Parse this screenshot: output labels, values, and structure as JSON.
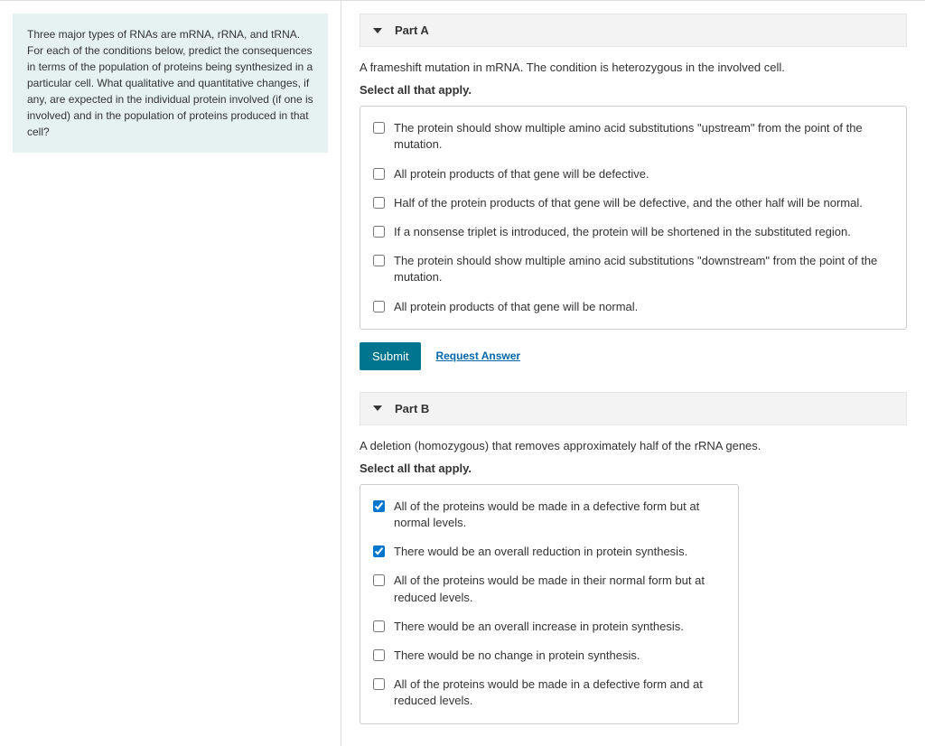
{
  "prompt": "Three major types of RNAs are mRNA, rRNA, and tRNA. For each of the conditions below, predict the consequences in terms of the population of proteins being synthesized in a particular cell. What qualitative and quantitative changes, if any, are expected in the individual protein involved (if one is involved) and in the population of proteins produced in that cell?",
  "partA": {
    "title": "Part A",
    "description": "A frameshift mutation in mRNA. The condition is heterozygous in the involved cell.",
    "selectLabel": "Select all that apply.",
    "options": [
      "The protein should show multiple amino acid substitutions \"upstream\" from the point of the mutation.",
      "All protein products of that gene will be defective.",
      "Half of the protein products of that gene will be defective, and the other half will be normal.",
      "If a nonsense triplet is introduced, the protein will be shortened in the substituted region.",
      "The protein should show multiple amino acid substitutions \"downstream\" from the point of the mutation.",
      "All protein products of that gene will be normal."
    ],
    "checked": [
      false,
      false,
      false,
      false,
      false,
      false
    ],
    "submitLabel": "Submit",
    "requestLabel": "Request Answer"
  },
  "partB": {
    "title": "Part B",
    "description": "A deletion (homozygous) that removes approximately half of the rRNA genes.",
    "selectLabel": "Select all that apply.",
    "options": [
      "All of the proteins would be made in a defective form but at normal levels.",
      "There would be an overall reduction in protein synthesis.",
      "All of the proteins would be made in their normal form but at reduced levels.",
      "There would be an overall increase in protein synthesis.",
      "There would be no change in protein synthesis.",
      "All of the proteins would be made in a defective form and at reduced levels."
    ],
    "checked": [
      true,
      true,
      false,
      false,
      false,
      false
    ]
  }
}
